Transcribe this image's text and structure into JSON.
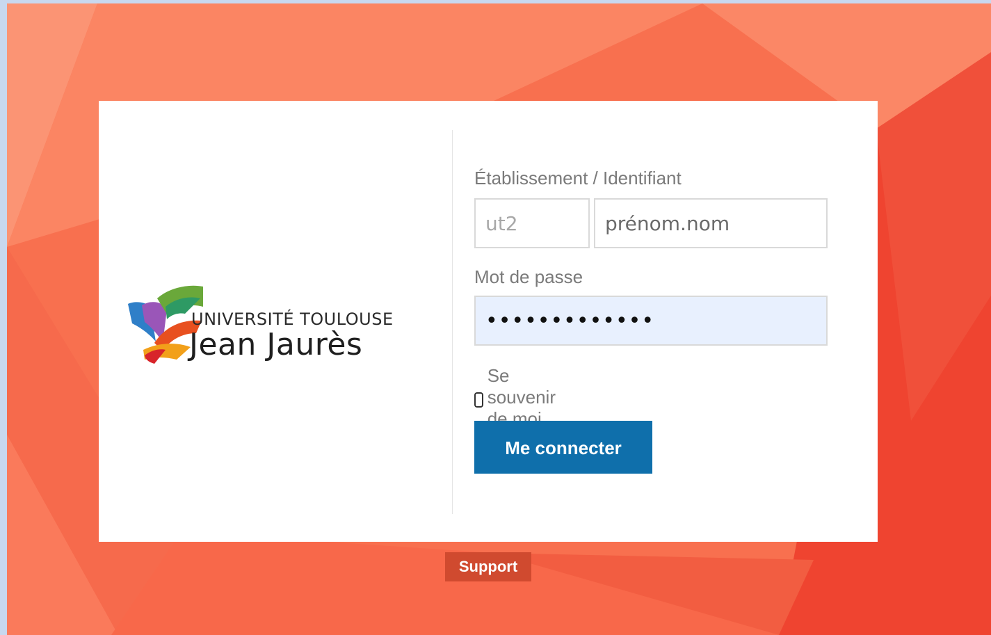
{
  "colors": {
    "background": "#f8704f",
    "primary_button": "#0f6fab",
    "support_button": "#d04a2f",
    "password_fill": "#e8f0fe"
  },
  "logo": {
    "icon": "ut2j-ribbon-logo-icon",
    "line1": "UNIVERSITÉ TOULOUSE",
    "line2": "Jean Jaurès"
  },
  "form": {
    "identifier_label": "Établissement / Identifiant",
    "establishment_placeholder": "ut2",
    "identifier_placeholder": "prénom.nom",
    "password_label": "Mot de passe",
    "password_value": "•••••••••••••",
    "remember_label": "Se souvenir de moi",
    "remember_checked": false,
    "submit_label": "Me connecter"
  },
  "footer": {
    "support_label": "Support"
  }
}
